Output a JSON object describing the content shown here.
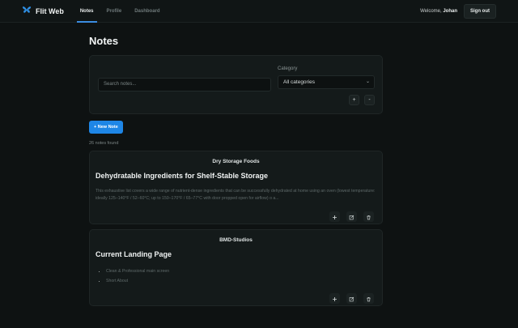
{
  "app": {
    "name": "Flit Web"
  },
  "nav": {
    "items": [
      {
        "label": "Notes"
      },
      {
        "label": "Profile"
      },
      {
        "label": "Dashboard"
      }
    ]
  },
  "user": {
    "welcome_prefix": "Welcome, ",
    "name": "Johan",
    "signout_label": "Sign out"
  },
  "page": {
    "title": "Notes"
  },
  "filters": {
    "search_placeholder": "Search notes...",
    "category_label": "Category",
    "category_value": "All categories",
    "plus_label": "+",
    "minus_label": "-"
  },
  "actions": {
    "new_note_label": "+ New Note"
  },
  "results": {
    "count_text": "26 notes found"
  },
  "notes": [
    {
      "category": "Dry Storage Foods",
      "title": "Dehydratable Ingredients for Shelf-Stable Storage",
      "body": "This exhaustive list covers a wide range of nutrient-dense ingredients that can be successfully dehydrated at home using an oven (lowest temperature: ideally 125–140°F / 52–60°C; up to 150–170°F / 65–77°C with door propped open for airflow) o a..."
    },
    {
      "category": "BMD-Studios",
      "title": "Current Landing Page",
      "list": [
        "Clean & Professional main screen",
        "Short About"
      ]
    }
  ],
  "colors": {
    "accent": "#1e86e6",
    "background": "#0e1212",
    "card": "#141a1a"
  },
  "icons": {
    "logo": "butterfly-icon",
    "add": "plus-icon",
    "edit": "edit-icon",
    "delete": "trash-icon"
  }
}
